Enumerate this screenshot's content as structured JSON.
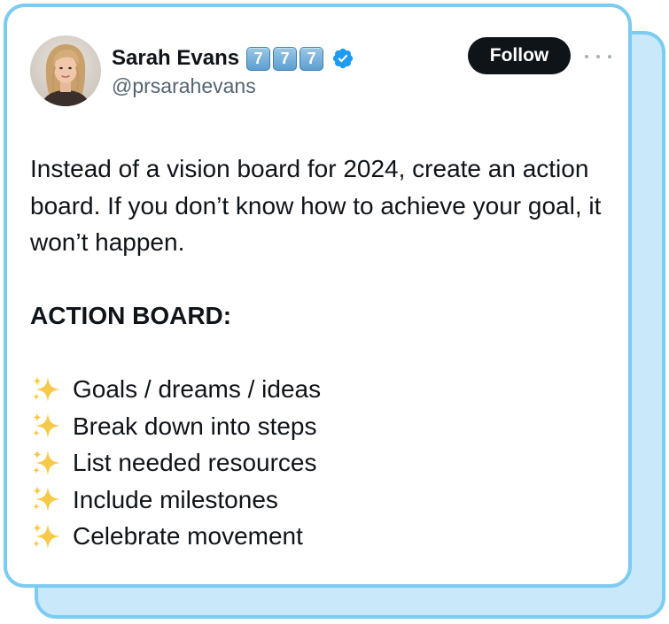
{
  "tweet": {
    "author": {
      "name": "Sarah Evans",
      "handle": "@prsarahevans",
      "badges": [
        "7",
        "7",
        "7"
      ],
      "verified_icon": "verified-badge-icon",
      "verified_color": "#1d9bf0"
    },
    "follow_label": "Follow",
    "more_icon": "more-options-icon",
    "text": {
      "intro": "Instead of a vision board for 2024, create an action board. If you don’t know how to achieve your goal, it won’t happen.",
      "heading": "ACTION BOARD:",
      "items": [
        {
          "icon": "sparkles-icon",
          "label": "Goals / dreams / ideas"
        },
        {
          "icon": "sparkles-icon",
          "label": "Break down into steps"
        },
        {
          "icon": "sparkles-icon",
          "label": "List needed resources"
        },
        {
          "icon": "sparkles-icon",
          "label": "Include milestones"
        },
        {
          "icon": "sparkles-icon",
          "label": "Celebrate movement"
        }
      ]
    }
  },
  "colors": {
    "card_border": "#7ccbf0",
    "back_card_fill": "#c9e9fb",
    "follow_button": "#0f1419",
    "handle_text": "#536471",
    "sparkle": "#f7c948"
  }
}
